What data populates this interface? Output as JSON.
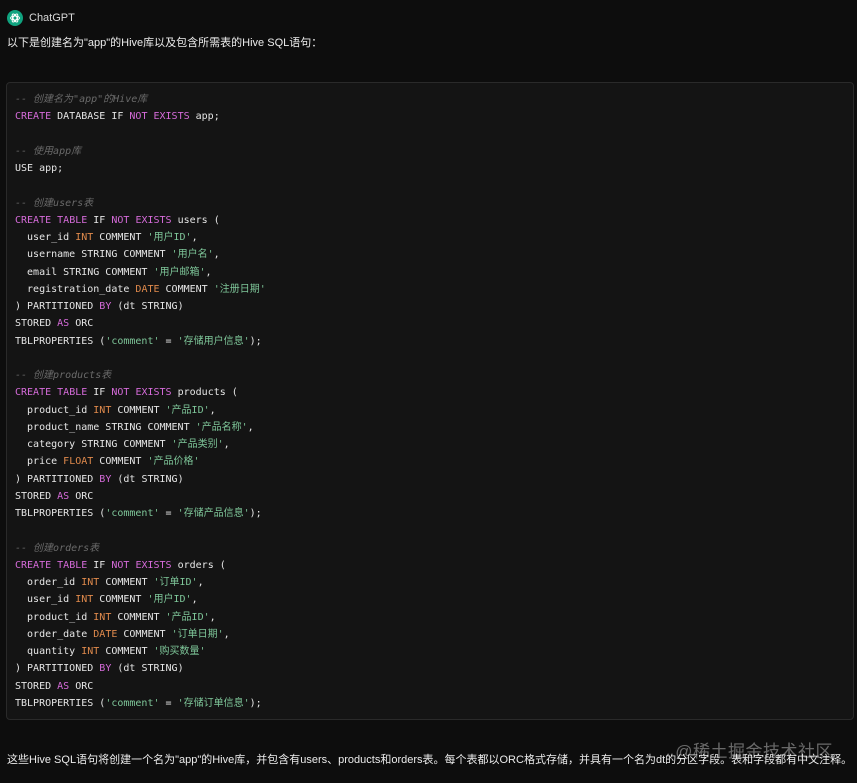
{
  "header": {
    "sender": "ChatGPT",
    "logo_icon": "openai-logo-icon",
    "logo_color": "#10a37f"
  },
  "message": {
    "intro": "以下是创建名为\"app\"的Hive库以及包含所需表的Hive SQL语句：",
    "outro": "这些Hive SQL语句将创建一个名为\"app\"的Hive库，并包含有users、products和orders表。每个表都以ORC格式存储，并具有一个名为dt的分区字段。表和字段都有中文注释。"
  },
  "code": {
    "language": "sql",
    "colors": {
      "keyword": "#d56bd9",
      "string": "#7ec699",
      "comment": "#6a6a6a",
      "type": "#e08a4c",
      "plain": "#e6e6e6",
      "background": "#141414"
    },
    "lines": [
      [
        [
          "cm",
          "-- 创建名为\"app\"的Hive库"
        ]
      ],
      [
        [
          "kw",
          "CREATE"
        ],
        [
          "fn",
          " DATABASE IF "
        ],
        [
          "kw",
          "NOT"
        ],
        [
          "fn",
          " "
        ],
        [
          "kw",
          "EXISTS"
        ],
        [
          "fn",
          " app;"
        ]
      ],
      [],
      [
        [
          "cm",
          "-- 使用app库"
        ]
      ],
      [
        [
          "fn",
          "USE app;"
        ]
      ],
      [],
      [
        [
          "cm",
          "-- 创建users表"
        ]
      ],
      [
        [
          "kw",
          "CREATE"
        ],
        [
          "fn",
          " "
        ],
        [
          "kw",
          "TABLE"
        ],
        [
          "fn",
          " IF "
        ],
        [
          "kw",
          "NOT"
        ],
        [
          "fn",
          " "
        ],
        [
          "kw",
          "EXISTS"
        ],
        [
          "fn",
          " users ("
        ]
      ],
      [
        [
          "fn",
          "  user_id "
        ],
        [
          "tp",
          "INT"
        ],
        [
          "fn",
          " COMMENT "
        ],
        [
          "str",
          "'用户ID'"
        ],
        [
          "fn",
          ","
        ]
      ],
      [
        [
          "fn",
          "  username STRING COMMENT "
        ],
        [
          "str",
          "'用户名'"
        ],
        [
          "fn",
          ","
        ]
      ],
      [
        [
          "fn",
          "  email STRING COMMENT "
        ],
        [
          "str",
          "'用户邮箱'"
        ],
        [
          "fn",
          ","
        ]
      ],
      [
        [
          "fn",
          "  registration_date "
        ],
        [
          "tp",
          "DATE"
        ],
        [
          "fn",
          " COMMENT "
        ],
        [
          "str",
          "'注册日期'"
        ]
      ],
      [
        [
          "fn",
          ") PARTITIONED "
        ],
        [
          "kw",
          "BY"
        ],
        [
          "fn",
          " (dt STRING)"
        ]
      ],
      [
        [
          "fn",
          "STORED "
        ],
        [
          "kw",
          "AS"
        ],
        [
          "fn",
          " ORC"
        ]
      ],
      [
        [
          "fn",
          "TBLPROPERTIES ("
        ],
        [
          "str",
          "'comment'"
        ],
        [
          "fn",
          " = "
        ],
        [
          "str",
          "'存储用户信息'"
        ],
        [
          "fn",
          ");"
        ]
      ],
      [],
      [
        [
          "cm",
          "-- 创建products表"
        ]
      ],
      [
        [
          "kw",
          "CREATE"
        ],
        [
          "fn",
          " "
        ],
        [
          "kw",
          "TABLE"
        ],
        [
          "fn",
          " IF "
        ],
        [
          "kw",
          "NOT"
        ],
        [
          "fn",
          " "
        ],
        [
          "kw",
          "EXISTS"
        ],
        [
          "fn",
          " products ("
        ]
      ],
      [
        [
          "fn",
          "  product_id "
        ],
        [
          "tp",
          "INT"
        ],
        [
          "fn",
          " COMMENT "
        ],
        [
          "str",
          "'产品ID'"
        ],
        [
          "fn",
          ","
        ]
      ],
      [
        [
          "fn",
          "  product_name STRING COMMENT "
        ],
        [
          "str",
          "'产品名称'"
        ],
        [
          "fn",
          ","
        ]
      ],
      [
        [
          "fn",
          "  category STRING COMMENT "
        ],
        [
          "str",
          "'产品类别'"
        ],
        [
          "fn",
          ","
        ]
      ],
      [
        [
          "fn",
          "  price "
        ],
        [
          "tp",
          "FLOAT"
        ],
        [
          "fn",
          " COMMENT "
        ],
        [
          "str",
          "'产品价格'"
        ]
      ],
      [
        [
          "fn",
          ") PARTITIONED "
        ],
        [
          "kw",
          "BY"
        ],
        [
          "fn",
          " (dt STRING)"
        ]
      ],
      [
        [
          "fn",
          "STORED "
        ],
        [
          "kw",
          "AS"
        ],
        [
          "fn",
          " ORC"
        ]
      ],
      [
        [
          "fn",
          "TBLPROPERTIES ("
        ],
        [
          "str",
          "'comment'"
        ],
        [
          "fn",
          " = "
        ],
        [
          "str",
          "'存储产品信息'"
        ],
        [
          "fn",
          ");"
        ]
      ],
      [],
      [
        [
          "cm",
          "-- 创建orders表"
        ]
      ],
      [
        [
          "kw",
          "CREATE"
        ],
        [
          "fn",
          " "
        ],
        [
          "kw",
          "TABLE"
        ],
        [
          "fn",
          " IF "
        ],
        [
          "kw",
          "NOT"
        ],
        [
          "fn",
          " "
        ],
        [
          "kw",
          "EXISTS"
        ],
        [
          "fn",
          " orders ("
        ]
      ],
      [
        [
          "fn",
          "  order_id "
        ],
        [
          "tp",
          "INT"
        ],
        [
          "fn",
          " COMMENT "
        ],
        [
          "str",
          "'订单ID'"
        ],
        [
          "fn",
          ","
        ]
      ],
      [
        [
          "fn",
          "  user_id "
        ],
        [
          "tp",
          "INT"
        ],
        [
          "fn",
          " COMMENT "
        ],
        [
          "str",
          "'用户ID'"
        ],
        [
          "fn",
          ","
        ]
      ],
      [
        [
          "fn",
          "  product_id "
        ],
        [
          "tp",
          "INT"
        ],
        [
          "fn",
          " COMMENT "
        ],
        [
          "str",
          "'产品ID'"
        ],
        [
          "fn",
          ","
        ]
      ],
      [
        [
          "fn",
          "  order_date "
        ],
        [
          "tp",
          "DATE"
        ],
        [
          "fn",
          " COMMENT "
        ],
        [
          "str",
          "'订单日期'"
        ],
        [
          "fn",
          ","
        ]
      ],
      [
        [
          "fn",
          "  quantity "
        ],
        [
          "tp",
          "INT"
        ],
        [
          "fn",
          " COMMENT "
        ],
        [
          "str",
          "'购买数量'"
        ]
      ],
      [
        [
          "fn",
          ") PARTITIONED "
        ],
        [
          "kw",
          "BY"
        ],
        [
          "fn",
          " (dt STRING)"
        ]
      ],
      [
        [
          "fn",
          "STORED "
        ],
        [
          "kw",
          "AS"
        ],
        [
          "fn",
          " ORC"
        ]
      ],
      [
        [
          "fn",
          "TBLPROPERTIES ("
        ],
        [
          "str",
          "'comment'"
        ],
        [
          "fn",
          " = "
        ],
        [
          "str",
          "'存储订单信息'"
        ],
        [
          "fn",
          ");"
        ]
      ]
    ]
  },
  "watermark": "@稀土掘金技术社区"
}
